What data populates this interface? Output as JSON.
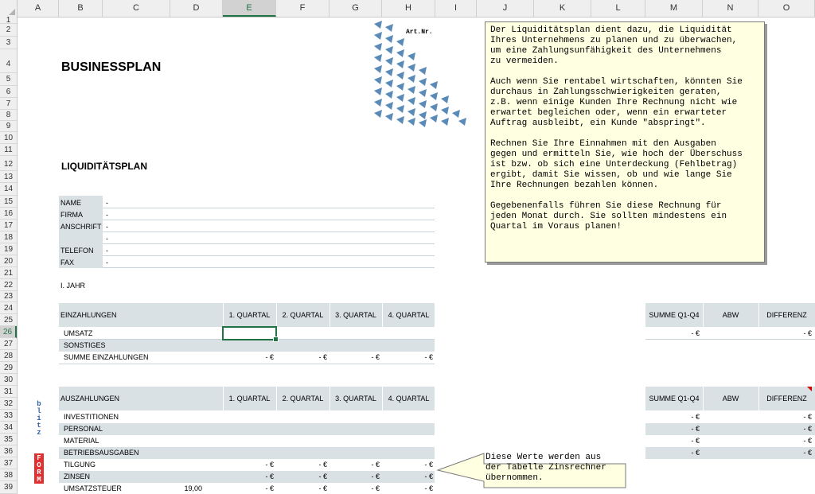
{
  "columns": [
    "A",
    "B",
    "C",
    "D",
    "E",
    "F",
    "G",
    "H",
    "I",
    "J",
    "K",
    "L",
    "M",
    "N",
    "O"
  ],
  "rows": [
    "1",
    "2",
    "3",
    "4",
    "5",
    "6",
    "7",
    "8",
    "9",
    "10",
    "11",
    "12",
    "13",
    "14",
    "15",
    "16",
    "17",
    "18",
    "19",
    "20",
    "21",
    "22",
    "23",
    "24",
    "25",
    "26",
    "27",
    "28",
    "29",
    "30",
    "31",
    "32",
    "33",
    "34",
    "35",
    "36",
    "37",
    "38",
    "39"
  ],
  "selected_cell": "E26",
  "title": "BUSINESSPLAN",
  "subtitle": "LIQUIDITÄTSPLAN",
  "logo_label": "Art.Nr.",
  "contact": [
    {
      "label": "NAME",
      "value": "-"
    },
    {
      "label": "FIRMA",
      "value": "-"
    },
    {
      "label": "ANSCHRIFT",
      "value": "-"
    },
    {
      "label": "",
      "value": "-"
    },
    {
      "label": "TELEFON",
      "value": "-"
    },
    {
      "label": "FAX",
      "value": "-"
    }
  ],
  "year_label": "I. JAHR",
  "einzahlungen": {
    "header": "EINZAHLUNGEN",
    "quarters": [
      "1. QUARTAL",
      "2. QUARTAL",
      "3. QUARTAL",
      "4. QUARTAL"
    ],
    "rows": [
      {
        "label": "UMSATZ",
        "values": [
          "",
          "",
          "",
          ""
        ]
      },
      {
        "label": "SONSTIGES",
        "values": [
          "",
          "",
          "",
          ""
        ]
      },
      {
        "label": "SUMME EINZAHLUNGEN",
        "values": [
          "- €",
          "- €",
          "- €",
          "- €"
        ]
      }
    ],
    "summary_header": [
      "SUMME Q1-Q4",
      "ABW",
      "DIFFERENZ"
    ],
    "summary_rows": [
      [
        "- €",
        "",
        "- €"
      ]
    ]
  },
  "auszahlungen": {
    "header": "AUSZAHLUNGEN",
    "quarters": [
      "1. QUARTAL",
      "2. QUARTAL",
      "3. QUARTAL",
      "4. QUARTAL"
    ],
    "rows": [
      {
        "label": "INVESTITIONEN",
        "extra": "",
        "values": [
          "",
          "",
          "",
          ""
        ]
      },
      {
        "label": "PERSONAL",
        "extra": "",
        "values": [
          "",
          "",
          "",
          ""
        ]
      },
      {
        "label": "MATERIAL",
        "extra": "",
        "values": [
          "",
          "",
          "",
          ""
        ]
      },
      {
        "label": "BETRIEBSAUSGABEN",
        "extra": "",
        "values": [
          "",
          "",
          "",
          ""
        ]
      },
      {
        "label": "TILGUNG",
        "extra": "",
        "values": [
          "- €",
          "- €",
          "- €",
          "- €"
        ]
      },
      {
        "label": "ZINSEN",
        "extra": "",
        "values": [
          "- €",
          "- €",
          "- €",
          "- €"
        ]
      },
      {
        "label": "UMSATZSTEUER",
        "extra": "19,00",
        "values": [
          "- €",
          "- €",
          "- €",
          "- €"
        ]
      }
    ],
    "summary_header": [
      "SUMME Q1-Q4",
      "ABW",
      "DIFFERENZ"
    ],
    "summary_rows": [
      [
        "- €",
        "",
        "- €"
      ],
      [
        "- €",
        "",
        "- €"
      ],
      [
        "- €",
        "",
        "- €"
      ],
      [
        "- €",
        "",
        "- €"
      ]
    ]
  },
  "note_main": "Der Liquiditätsplan dient dazu, die Liquidität\nIhres Unternehmens zu planen und zu überwachen,\num eine Zahlungsunfähigkeit des Unternehmens\nzu vermeiden.\n\nAuch wenn Sie rentabel wirtschaften, könnten Sie\ndurchaus in Zahlungsschwierigkeiten geraten,\nz.B. wenn einige Kunden Ihre Rechnung nicht wie\nerwartet begleichen oder, wenn ein erwarteter\nAuftrag ausbleibt, ein Kunde \"abspringt\".\n\nRechnen Sie Ihre Einnahmen mit den Ausgaben\ngegen und ermitteln Sie, wie hoch der Überschuss\nist bzw. ob sich eine Unterdeckung (Fehlbetrag)\nergibt, damit Sie wissen, ob und wie lange Sie\nIhre Rechnungen bezahlen können.\n\nGegebenenfalls führen Sie diese Rechnung für\njeden Monat durch. Sie sollten mindestens ein\nQuartal im Voraus planen!",
  "note_callout": "Diese Werte werden aus\nder Tabelle Zinsrechner\nübernommen.",
  "brand": {
    "part1": "FORM",
    "part2": "blitz"
  },
  "colors": {
    "header_bg": "#efefef",
    "band": "#d9e1e5",
    "accent": "#217346",
    "note_bg": "#ffffe1",
    "brand_red": "#e03030",
    "brand_blue": "#2f5fa7"
  }
}
